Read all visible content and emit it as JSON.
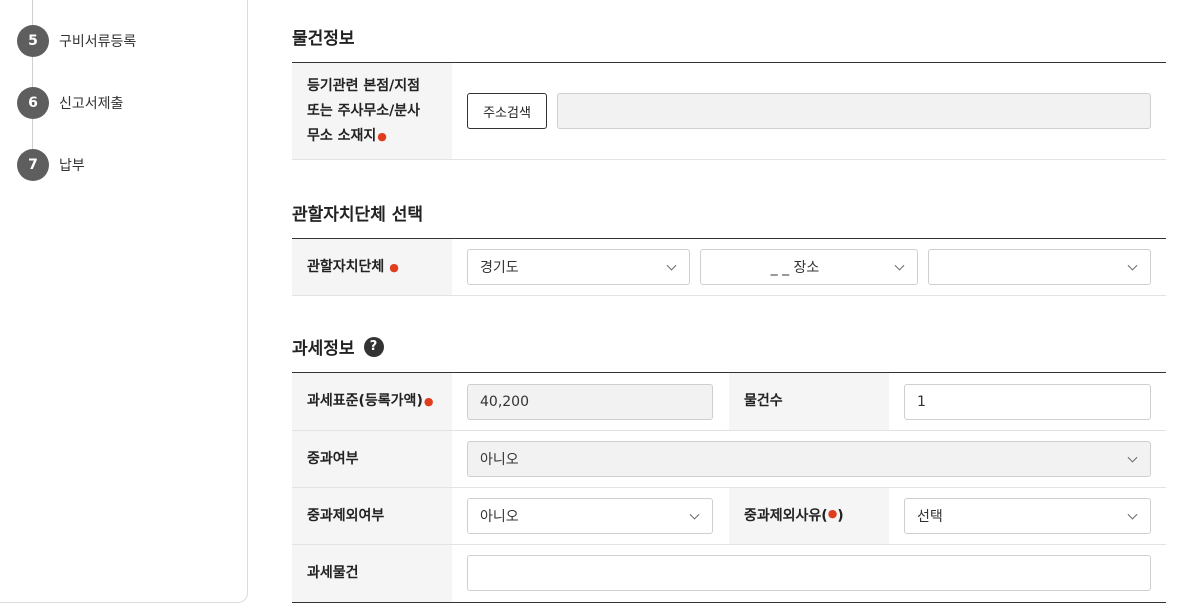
{
  "steps": [
    {
      "num": "5",
      "label": "구비서류등록"
    },
    {
      "num": "6",
      "label": "신고서제출"
    },
    {
      "num": "7",
      "label": "납부"
    }
  ],
  "property_section": {
    "title": "물건정보",
    "location_label_line1": "등기관련 본점/지점",
    "location_label_line2": "또는 주사무소/분사",
    "location_label_line3": "무소 소재지",
    "address_search_button": "주소검색",
    "address_value": ""
  },
  "jurisdiction_section": {
    "title": "관할자치단체 선택",
    "label": "관할자치단체",
    "province_value": "경기도",
    "city_value": "_ _ 장소",
    "district_value": ""
  },
  "tax_section": {
    "title": "과세정보",
    "help_icon": "?",
    "tax_base_label": "과세표준(등록가액)",
    "tax_base_value": "40,200",
    "item_count_label": "물건수",
    "item_count_value": "1",
    "surcharge_label": "중과여부",
    "surcharge_value": "아니오",
    "exclusion_label": "중과제외여부",
    "exclusion_value": "아니오",
    "exclusion_reason_label": "중과제외사유(",
    "exclusion_reason_label_end": ")",
    "exclusion_reason_value": "선택",
    "taxable_item_label": "과세물건",
    "taxable_item_value": ""
  },
  "colors": {
    "required_mark": "#e03c1e",
    "step_circle": "#5e5e5e",
    "header_bg": "#f5f5f5"
  }
}
